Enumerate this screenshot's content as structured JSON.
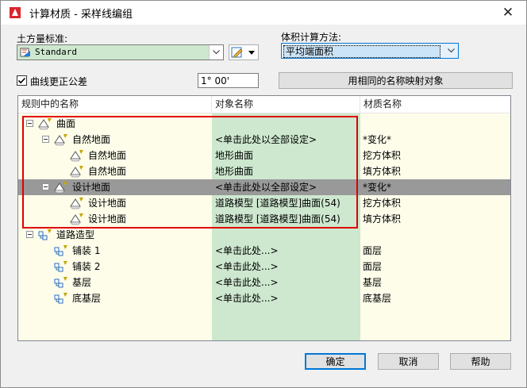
{
  "window": {
    "title": "计算材质 - 采样线编组",
    "close": "✕"
  },
  "form": {
    "earthwork_label": "土方量标准:",
    "earthwork_value": "Standard",
    "volume_method_label": "体积计算方法:",
    "volume_method_value": "平均端面积",
    "curve_correction_label": "曲线更正公差",
    "curve_correction_checked": true,
    "tolerance_value": "1° 00'",
    "map_button": "用相同的名称映射对象"
  },
  "list": {
    "headers": [
      "规则中的名称",
      "对象名称",
      "材质名称"
    ],
    "rows": [
      {
        "name": "曲面",
        "object": "",
        "material": "",
        "level": 0,
        "icon": "surface"
      },
      {
        "name": "自然地面",
        "object": "<单击此处以全部设定>",
        "material": "*变化*",
        "level": 1,
        "icon": "surface"
      },
      {
        "name": "自然地面",
        "object": "地形曲面",
        "material": "挖方体积",
        "level": 2,
        "icon": "surface"
      },
      {
        "name": "自然地面",
        "object": "地形曲面",
        "material": "填方体积",
        "level": 2,
        "icon": "surface"
      },
      {
        "name": "设计地面",
        "object": "<单击此处以全部设定>",
        "material": "*变化*",
        "level": 1,
        "icon": "surface",
        "selected": true
      },
      {
        "name": "设计地面",
        "object": "道路模型 [道路模型]曲面(54)",
        "material": "挖方体积",
        "level": 2,
        "icon": "surface"
      },
      {
        "name": "设计地面",
        "object": "道路模型 [道路模型]曲面(54)",
        "material": "填方体积",
        "level": 2,
        "icon": "surface"
      },
      {
        "name": "道路造型",
        "object": "",
        "material": "",
        "level": 0,
        "icon": "corridor"
      },
      {
        "name": "铺装 1",
        "object": "<单击此处...>",
        "material": "面层",
        "level": 1,
        "icon": "corridor"
      },
      {
        "name": "铺装 2",
        "object": "<单击此处...>",
        "material": "面层",
        "level": 1,
        "icon": "corridor"
      },
      {
        "name": "基层",
        "object": "<单击此处...>",
        "material": "基层",
        "level": 1,
        "icon": "corridor"
      },
      {
        "name": "底基层",
        "object": "<单击此处...>",
        "material": "底基层",
        "level": 1,
        "icon": "corridor"
      }
    ]
  },
  "buttons": {
    "ok": "确定",
    "cancel": "取消",
    "help": "帮助"
  },
  "colors": {
    "object_col": "#cde8cf",
    "name_col": "#fdfdea",
    "selected": "#999999",
    "highlight": "#e00000"
  }
}
